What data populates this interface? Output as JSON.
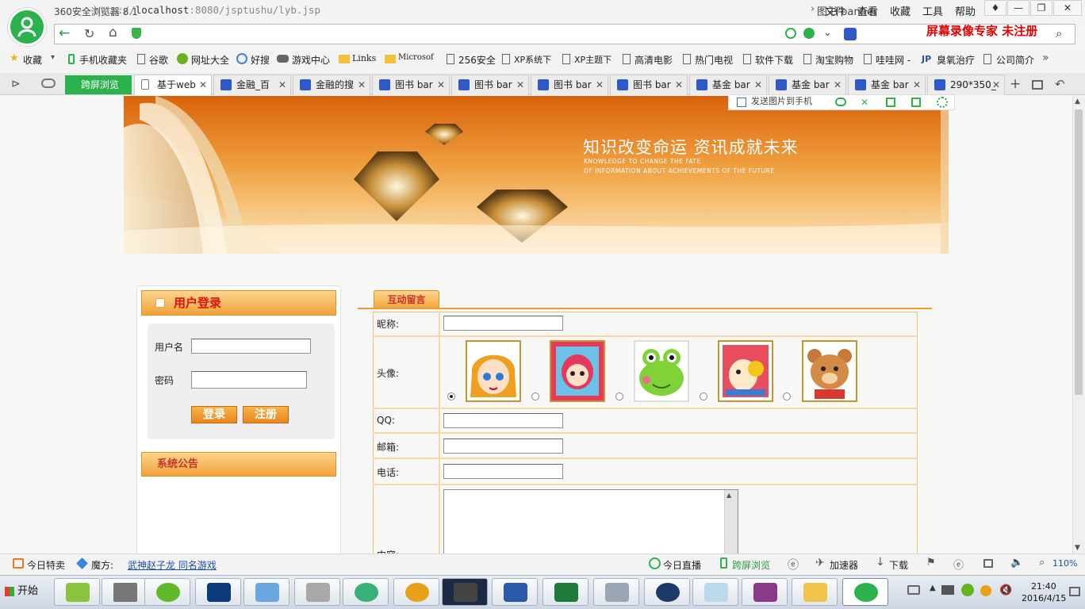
{
  "window": {
    "app_title": "360安全浏览器 8.1",
    "menu": [
      "文件",
      "查看",
      "收藏",
      "工具",
      "帮助"
    ],
    "controls": {
      "minimize": "—",
      "restore": "❐",
      "close": "✕"
    }
  },
  "addressbar": {
    "url_host": "localhost",
    "url_rest": ":8080/jsptushu/lyb.jsp",
    "url_scheme": "http://",
    "search_text": "图书 banner",
    "recorder_watermark": "屏幕录像专家  未注册"
  },
  "bookmarks": [
    "收藏",
    "手机收藏夹",
    "谷歌",
    "网址大全",
    "好搜",
    "游戏中心",
    "Links",
    "Microsof",
    "256安全",
    "XP系统下",
    "XP主题下",
    "高清电影",
    "热门电视",
    "软件下载",
    "淘宝购物",
    "哇哇网 -",
    "臭氧治疗",
    "公司简介"
  ],
  "tabs": {
    "green": "跨屏浏览",
    "items": [
      "基于web",
      "金融_百",
      "金融的搜",
      "图书 bar",
      "图书 bar",
      "图书 bar",
      "图书 bar",
      "基金 bar",
      "基金 bar",
      "基金 bar",
      "290*350_"
    ]
  },
  "banner": {
    "slogan": "知识改变命运 资讯成就未来",
    "en_line1": "KNOWLEDGE TO CHANGE THE FATE",
    "en_line2": "OF INFORMATION ABOUT ACHIEVEMENTS OF THE FUTURE",
    "float_toolbar": "发送图片到手机"
  },
  "login": {
    "title": "用户登录",
    "username_label": "用户名",
    "password_label": "密码",
    "login_button": "登录",
    "register_button": "注册",
    "notice_title": "系统公告"
  },
  "message": {
    "tab": "互动留言",
    "nickname_label": "昵称:",
    "avatar_label": "头像:",
    "qq_label": "QQ:",
    "email_label": "邮箱:",
    "phone_label": "电话:",
    "content_label": "内容:",
    "avatar_selected_index": 0
  },
  "statusbar": {
    "left": [
      "今日特卖",
      "魔方:",
      "武神赵子龙 同名游戏"
    ],
    "right": [
      "今日直播",
      "跨屏浏览",
      "加速器",
      "下载"
    ],
    "zoom": "110%"
  },
  "taskbar": {
    "start": "开始",
    "time": "21:40",
    "date": "2016/4/15"
  }
}
